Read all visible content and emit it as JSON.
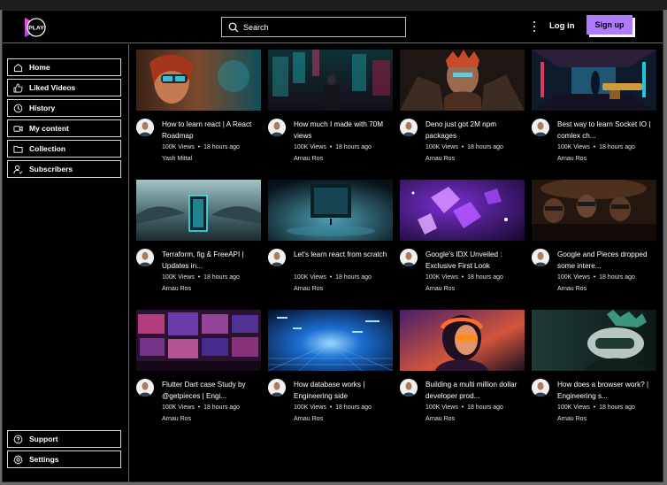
{
  "header": {
    "logo_text": "PLAY",
    "search_placeholder": "Search",
    "login_label": "Log in",
    "signup_label": "Sign up",
    "colors": {
      "accent": "#ae7aff",
      "background": "#000000"
    }
  },
  "sidebar": {
    "items": [
      {
        "label": "Home",
        "icon": "home-icon"
      },
      {
        "label": "Liked Videos",
        "icon": "thumbs-up-icon"
      },
      {
        "label": "History",
        "icon": "history-icon"
      },
      {
        "label": "My content",
        "icon": "video-camera-icon"
      },
      {
        "label": "Collection",
        "icon": "folder-icon"
      },
      {
        "label": "Subscribers",
        "icon": "user-check-icon"
      }
    ],
    "bottom_items": [
      {
        "label": "Support",
        "icon": "help-circle-icon"
      },
      {
        "label": "Settings",
        "icon": "gear-icon"
      }
    ]
  },
  "videos": [
    {
      "title": "How to learn react | A React Roadmap",
      "views": "100K Views",
      "time": "18 hours ago",
      "author": "Yash Mittal"
    },
    {
      "title": "How much I made with 70M views",
      "views": "100K Views",
      "time": "18 hours ago",
      "author": "Arnau Ros"
    },
    {
      "title": "Deno just got 2M npm packages",
      "views": "100K Views",
      "time": "18 hours ago",
      "author": "Arnau Ros"
    },
    {
      "title": "Best way to learn Socket IO | comlex ch...",
      "views": "100K Views",
      "time": "18 hours ago",
      "author": "Arnau Ros"
    },
    {
      "title": "Terraform, fig & FreeAPI | Updates in...",
      "views": "100K Views",
      "time": "18 hours ago",
      "author": "Arnau Ros"
    },
    {
      "title": "Let's learn react from scratch",
      "views": "100K Views",
      "time": "18 hours ago",
      "author": "Arnau Ros"
    },
    {
      "title": "Google's IDX Unveiled : Exclusive First Look",
      "views": "100K Views",
      "time": "18 hours ago",
      "author": "Arnau Ros"
    },
    {
      "title": "Google and Pieces dropped some intere...",
      "views": "100K Views",
      "time": "18 hours ago",
      "author": "Arnau Ros"
    },
    {
      "title": "Flutter Dart case Study by @getpieces | Engi...",
      "views": "100K Views",
      "time": "18 hours ago",
      "author": "Arnau Ros"
    },
    {
      "title": "How database works | Engineering side",
      "views": "100K Views",
      "time": "18 hours ago",
      "author": "Arnau Ros"
    },
    {
      "title": "Building a multi million dollar developer prod...",
      "views": "100K Views",
      "time": "18 hours ago",
      "author": "Arnau Ros"
    },
    {
      "title": "How does a browser work? | Engineering s...",
      "views": "100K Views",
      "time": "18 hours ago",
      "author": "Arnau Ros"
    }
  ]
}
